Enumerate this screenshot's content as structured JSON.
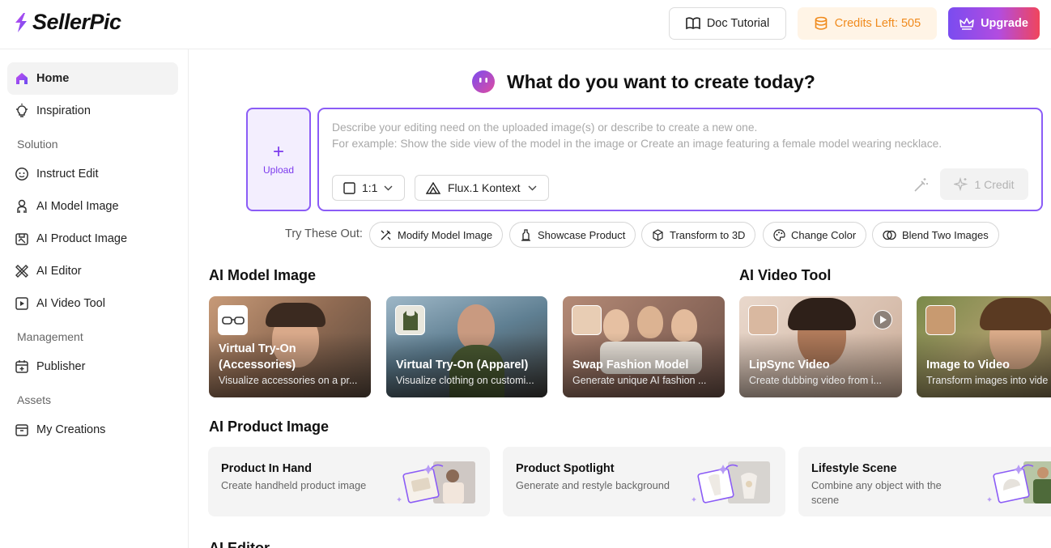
{
  "app": {
    "brand": "SellerPic",
    "doc_tutorial": "Doc Tutorial",
    "credits": "Credits Left: 505",
    "upgrade": "Upgrade"
  },
  "sidebar": {
    "home": "Home",
    "inspiration": "Inspiration",
    "solution_header": "Solution",
    "instruct_edit": "Instruct Edit",
    "ai_model_image": "AI Model Image",
    "ai_product_image": "AI Product Image",
    "ai_editor": "AI Editor",
    "ai_video_tool": "AI Video Tool",
    "management_header": "Management",
    "publisher": "Publisher",
    "assets_header": "Assets",
    "my_creations": "My Creations"
  },
  "composer": {
    "title": "What do you want to create today?",
    "upload": "Upload",
    "placeholder_line1": "Describe your editing need on the uploaded image(s) or describe to create a new one.",
    "placeholder_line2": "For example: Show the side view of the model in the image or Create an image featuring a female model wearing necklace.",
    "ratio": "1:1",
    "model": "Flux.1 Kontext",
    "generate": "1 Credit"
  },
  "suggestions": {
    "label": "Try These Out:",
    "chips": [
      "Modify Model Image",
      "Showcase Product",
      "Transform to 3D",
      "Change Color",
      "Blend Two Images"
    ]
  },
  "model_section": {
    "title": "AI Model Image",
    "cards": [
      {
        "title": "Virtual Try-On (Accessories)",
        "desc": "Visualize accessories on a pr..."
      },
      {
        "title": "Virtual Try-On (Apparel)",
        "desc": "Visualize clothing on customi..."
      },
      {
        "title": "Swap Fashion Model",
        "desc": "Generate unique AI fashion ..."
      }
    ]
  },
  "video_section": {
    "title": "AI Video Tool",
    "cards": [
      {
        "title": "LipSync Video",
        "desc": "Create dubbing video from i..."
      },
      {
        "title": "Image to Video",
        "desc": "Transform images into vide"
      }
    ]
  },
  "product_section": {
    "title": "AI Product Image",
    "cards": [
      {
        "title": "Product In Hand",
        "desc": "Create handheld product image"
      },
      {
        "title": "Product Spotlight",
        "desc": "Generate and restyle background"
      },
      {
        "title": "Lifestyle Scene",
        "desc": "Combine any object with the scene"
      }
    ]
  },
  "editor_section": {
    "title": "AI Editor"
  },
  "colors": {
    "accent": "#8b5cf6",
    "credits": "#f08a1c",
    "upgrade_start": "#7a4cf0",
    "upgrade_end": "#f0455c"
  }
}
